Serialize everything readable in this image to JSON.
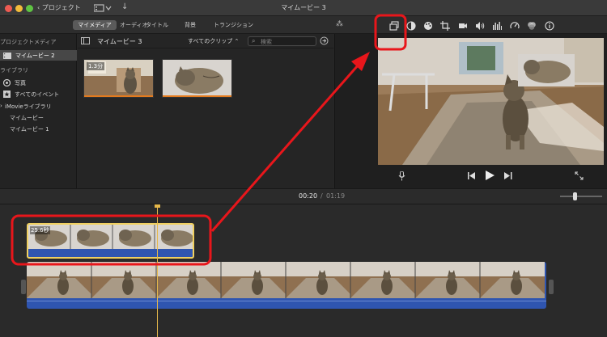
{
  "titlebar": {
    "back_label": "プロジェクト",
    "title": "マイムービー 3"
  },
  "toolbar": {
    "tabs": [
      "マイメディア",
      "オーディオ",
      "タイトル",
      "背景",
      "トランジション"
    ]
  },
  "sidebar": {
    "project_media_header": "プロジェクトメディア",
    "project_item": "マイムービー 2",
    "library_header": "ライブラリ",
    "photos": "写真",
    "all_events": "すべてのイベント",
    "imovie_library": "iMovieライブラリ",
    "movie1": "マイムービー",
    "movie2": "マイムービー 1"
  },
  "browser": {
    "title": "マイムービー 3",
    "filter": "すべてのクリップ",
    "search_placeholder": "検索",
    "clip1_duration": "1.3分"
  },
  "timeline": {
    "current_time": "00:20",
    "separator": "/",
    "total_time": "01:19",
    "overlay_clip_duration": "25.6秒"
  },
  "colors": {
    "annotation": "#e8161b",
    "clip_blue": "#2f55b0",
    "playhead": "#e6b84a",
    "selection": "#f0d060"
  }
}
